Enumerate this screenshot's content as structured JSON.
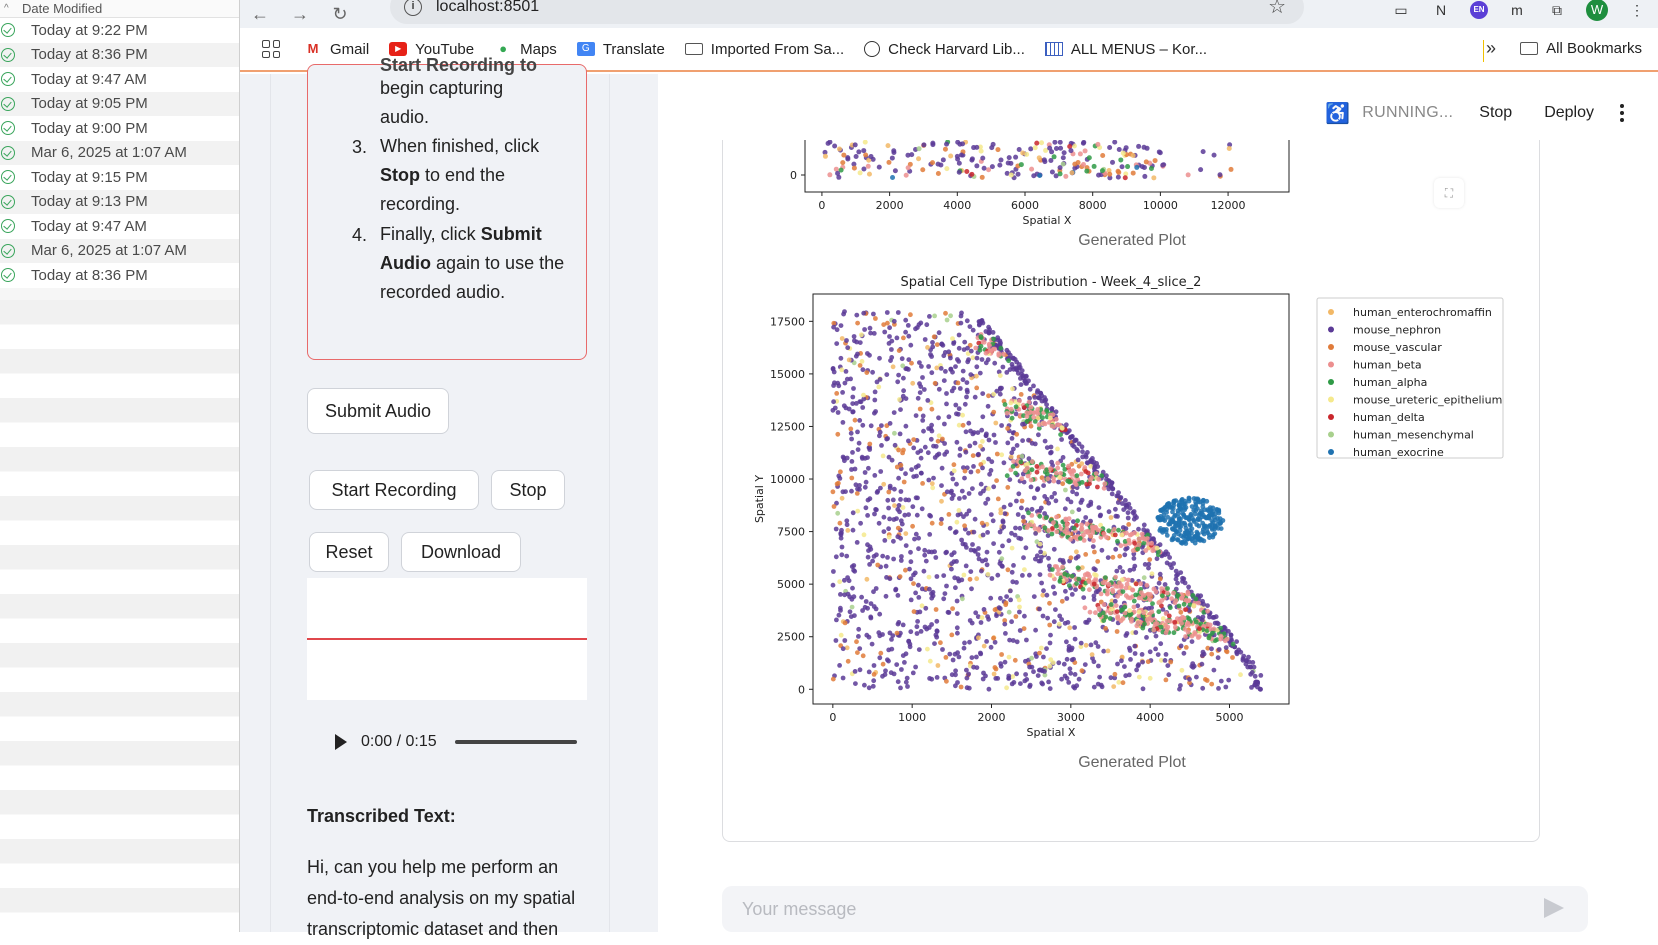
{
  "finder": {
    "header": "Date Modified",
    "rows": [
      "Today at 9:22 PM",
      "Today at 8:36 PM",
      "Today at 9:47 AM",
      "Today at 9:05 PM",
      "Today at 9:00 PM",
      "Mar 6, 2025 at 1:07 AM",
      "Today at 9:15 PM",
      "Today at 9:13 PM",
      "Today at 9:47 AM",
      "Mar 6, 2025 at 1:07 AM",
      "Today at 8:36 PM"
    ]
  },
  "browser": {
    "url": "localhost:8501",
    "bookmarks": [
      {
        "label": "Gmail",
        "icon": "gmail-icon"
      },
      {
        "label": "YouTube",
        "icon": "youtube-icon"
      },
      {
        "label": "Maps",
        "icon": "maps-icon"
      },
      {
        "label": "Translate",
        "icon": "translate-icon"
      },
      {
        "label": "Imported From Sa...",
        "icon": "folder-icon"
      },
      {
        "label": "Check Harvard Lib...",
        "icon": "globe-icon"
      },
      {
        "label": "ALL MENUS – Kor...",
        "icon": "grid-icon"
      }
    ],
    "more": "»",
    "all_bookmarks": "All Bookmarks"
  },
  "sidebar": {
    "instructions": {
      "clipped_line": "Start Recording to",
      "line1": "begin capturing",
      "line2": "audio.",
      "step3_num": "3.",
      "step3_a": "When finished, click",
      "step3_bold": "Stop",
      "step3_b": " to end the",
      "step3_c": "recording.",
      "step4_num": "4.",
      "step4_a": "Finally, click ",
      "step4_bold1": "Submit",
      "step4_bold2": "Audio",
      "step4_b": " again to use the",
      "step4_c": "recorded audio."
    },
    "submit_audio": "Submit Audio",
    "start_recording": "Start Recording",
    "stop": "Stop",
    "reset": "Reset",
    "download": "Download",
    "player_time": "0:00 / 0:15",
    "transcribed_label": "Transcribed Text:",
    "transcribed_text": "Hi, can you help me perform an end-to-end analysis on my spatial transcriptomic dataset and then"
  },
  "header": {
    "running": "RUNNING...",
    "stop": "Stop",
    "deploy": "Deploy"
  },
  "plots": {
    "caption_top": "Generated Plot",
    "caption_bottom": "Generated Plot"
  },
  "chat": {
    "placeholder": "Your message"
  },
  "colors": {
    "human_enterochromaffin": "#f2b866",
    "mouse_nephron": "#5b3a96",
    "mouse_vascular": "#e07b3a",
    "human_beta": "#ec8f8f",
    "human_alpha": "#2f9a46",
    "mouse_ureteric_epithelium": "#f5e98c",
    "human_delta": "#c9262c",
    "human_mesenchymal": "#a8d08d",
    "human_exocrine": "#1f72b0"
  },
  "chart_data": [
    {
      "type": "scatter",
      "title": "",
      "xlabel": "Spatial X",
      "ylabel": "",
      "xlim": [
        -500,
        13800
      ],
      "xticks": [
        0,
        2000,
        4000,
        6000,
        8000,
        10000,
        12000
      ],
      "yticks": [
        0
      ],
      "note": "partially visible (cropped at top)"
    },
    {
      "type": "scatter",
      "title": "Spatial Cell Type Distribution - Week_4_slice_2",
      "xlabel": "Spatial X",
      "ylabel": "Spatial Y",
      "xlim": [
        -250,
        5750
      ],
      "ylim": [
        -700,
        18800
      ],
      "xticks": [
        0,
        1000,
        2000,
        3000,
        4000,
        5000
      ],
      "yticks": [
        0,
        2500,
        5000,
        7500,
        10000,
        12500,
        15000,
        17500
      ],
      "legend_position": "outside-right",
      "series": [
        {
          "name": "human_enterochromaffin",
          "color": "#f2b866"
        },
        {
          "name": "mouse_nephron",
          "color": "#5b3a96"
        },
        {
          "name": "mouse_vascular",
          "color": "#e07b3a"
        },
        {
          "name": "human_beta",
          "color": "#ec8f8f"
        },
        {
          "name": "human_alpha",
          "color": "#2f9a46"
        },
        {
          "name": "mouse_ureteric_epithelium",
          "color": "#f5e98c"
        },
        {
          "name": "human_delta",
          "color": "#c9262c"
        },
        {
          "name": "human_mesenchymal",
          "color": "#a8d08d"
        },
        {
          "name": "human_exocrine",
          "color": "#1f72b0"
        }
      ]
    }
  ]
}
